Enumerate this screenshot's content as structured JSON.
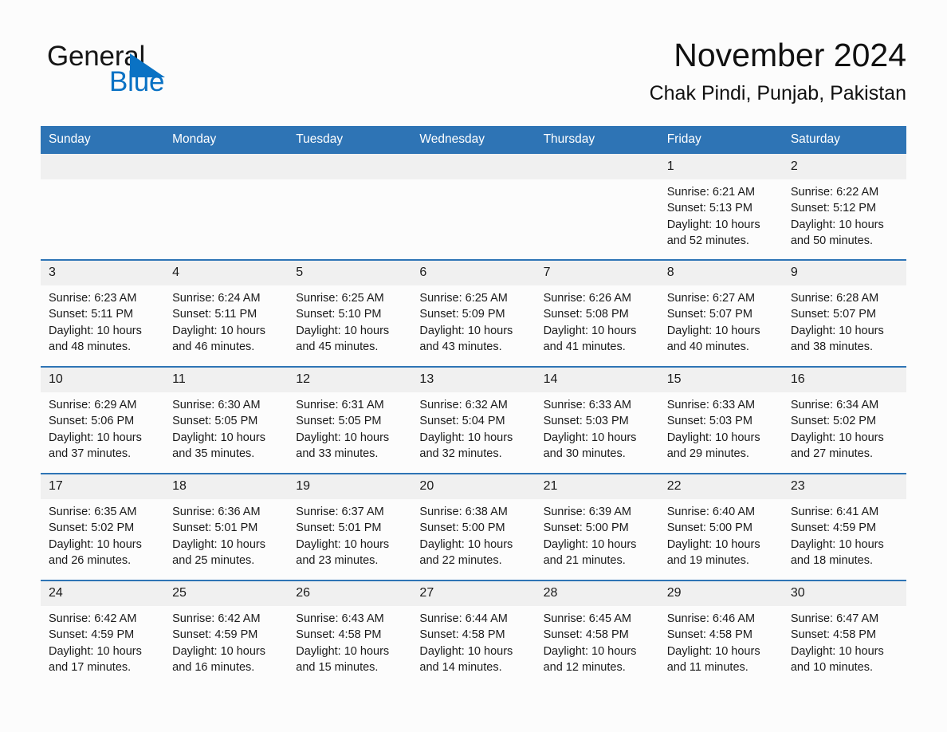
{
  "brand": {
    "name_part1": "General",
    "name_part2": "Blue",
    "triangle_icon": "triangle-logo-icon",
    "accent_color": "#0a72c4"
  },
  "header": {
    "title": "November 2024",
    "location": "Chak Pindi, Punjab, Pakistan"
  },
  "theme": {
    "header_blue": "#2e74b5",
    "row_border_blue": "#2e74b5",
    "daynum_band": "#f0f0f0",
    "page_background": "#fcfcfc"
  },
  "weekday_headers": [
    "Sunday",
    "Monday",
    "Tuesday",
    "Wednesday",
    "Thursday",
    "Friday",
    "Saturday"
  ],
  "weeks": [
    [
      {
        "day": "",
        "empty": true
      },
      {
        "day": "",
        "empty": true
      },
      {
        "day": "",
        "empty": true
      },
      {
        "day": "",
        "empty": true
      },
      {
        "day": "",
        "empty": true
      },
      {
        "day": "1",
        "sunrise": "Sunrise: 6:21 AM",
        "sunset": "Sunset: 5:13 PM",
        "daylight_line1": "Daylight: 10 hours",
        "daylight_line2": "and 52 minutes."
      },
      {
        "day": "2",
        "sunrise": "Sunrise: 6:22 AM",
        "sunset": "Sunset: 5:12 PM",
        "daylight_line1": "Daylight: 10 hours",
        "daylight_line2": "and 50 minutes."
      }
    ],
    [
      {
        "day": "3",
        "sunrise": "Sunrise: 6:23 AM",
        "sunset": "Sunset: 5:11 PM",
        "daylight_line1": "Daylight: 10 hours",
        "daylight_line2": "and 48 minutes."
      },
      {
        "day": "4",
        "sunrise": "Sunrise: 6:24 AM",
        "sunset": "Sunset: 5:11 PM",
        "daylight_line1": "Daylight: 10 hours",
        "daylight_line2": "and 46 minutes."
      },
      {
        "day": "5",
        "sunrise": "Sunrise: 6:25 AM",
        "sunset": "Sunset: 5:10 PM",
        "daylight_line1": "Daylight: 10 hours",
        "daylight_line2": "and 45 minutes."
      },
      {
        "day": "6",
        "sunrise": "Sunrise: 6:25 AM",
        "sunset": "Sunset: 5:09 PM",
        "daylight_line1": "Daylight: 10 hours",
        "daylight_line2": "and 43 minutes."
      },
      {
        "day": "7",
        "sunrise": "Sunrise: 6:26 AM",
        "sunset": "Sunset: 5:08 PM",
        "daylight_line1": "Daylight: 10 hours",
        "daylight_line2": "and 41 minutes."
      },
      {
        "day": "8",
        "sunrise": "Sunrise: 6:27 AM",
        "sunset": "Sunset: 5:07 PM",
        "daylight_line1": "Daylight: 10 hours",
        "daylight_line2": "and 40 minutes."
      },
      {
        "day": "9",
        "sunrise": "Sunrise: 6:28 AM",
        "sunset": "Sunset: 5:07 PM",
        "daylight_line1": "Daylight: 10 hours",
        "daylight_line2": "and 38 minutes."
      }
    ],
    [
      {
        "day": "10",
        "sunrise": "Sunrise: 6:29 AM",
        "sunset": "Sunset: 5:06 PM",
        "daylight_line1": "Daylight: 10 hours",
        "daylight_line2": "and 37 minutes."
      },
      {
        "day": "11",
        "sunrise": "Sunrise: 6:30 AM",
        "sunset": "Sunset: 5:05 PM",
        "daylight_line1": "Daylight: 10 hours",
        "daylight_line2": "and 35 minutes."
      },
      {
        "day": "12",
        "sunrise": "Sunrise: 6:31 AM",
        "sunset": "Sunset: 5:05 PM",
        "daylight_line1": "Daylight: 10 hours",
        "daylight_line2": "and 33 minutes."
      },
      {
        "day": "13",
        "sunrise": "Sunrise: 6:32 AM",
        "sunset": "Sunset: 5:04 PM",
        "daylight_line1": "Daylight: 10 hours",
        "daylight_line2": "and 32 minutes."
      },
      {
        "day": "14",
        "sunrise": "Sunrise: 6:33 AM",
        "sunset": "Sunset: 5:03 PM",
        "daylight_line1": "Daylight: 10 hours",
        "daylight_line2": "and 30 minutes."
      },
      {
        "day": "15",
        "sunrise": "Sunrise: 6:33 AM",
        "sunset": "Sunset: 5:03 PM",
        "daylight_line1": "Daylight: 10 hours",
        "daylight_line2": "and 29 minutes."
      },
      {
        "day": "16",
        "sunrise": "Sunrise: 6:34 AM",
        "sunset": "Sunset: 5:02 PM",
        "daylight_line1": "Daylight: 10 hours",
        "daylight_line2": "and 27 minutes."
      }
    ],
    [
      {
        "day": "17",
        "sunrise": "Sunrise: 6:35 AM",
        "sunset": "Sunset: 5:02 PM",
        "daylight_line1": "Daylight: 10 hours",
        "daylight_line2": "and 26 minutes."
      },
      {
        "day": "18",
        "sunrise": "Sunrise: 6:36 AM",
        "sunset": "Sunset: 5:01 PM",
        "daylight_line1": "Daylight: 10 hours",
        "daylight_line2": "and 25 minutes."
      },
      {
        "day": "19",
        "sunrise": "Sunrise: 6:37 AM",
        "sunset": "Sunset: 5:01 PM",
        "daylight_line1": "Daylight: 10 hours",
        "daylight_line2": "and 23 minutes."
      },
      {
        "day": "20",
        "sunrise": "Sunrise: 6:38 AM",
        "sunset": "Sunset: 5:00 PM",
        "daylight_line1": "Daylight: 10 hours",
        "daylight_line2": "and 22 minutes."
      },
      {
        "day": "21",
        "sunrise": "Sunrise: 6:39 AM",
        "sunset": "Sunset: 5:00 PM",
        "daylight_line1": "Daylight: 10 hours",
        "daylight_line2": "and 21 minutes."
      },
      {
        "day": "22",
        "sunrise": "Sunrise: 6:40 AM",
        "sunset": "Sunset: 5:00 PM",
        "daylight_line1": "Daylight: 10 hours",
        "daylight_line2": "and 19 minutes."
      },
      {
        "day": "23",
        "sunrise": "Sunrise: 6:41 AM",
        "sunset": "Sunset: 4:59 PM",
        "daylight_line1": "Daylight: 10 hours",
        "daylight_line2": "and 18 minutes."
      }
    ],
    [
      {
        "day": "24",
        "sunrise": "Sunrise: 6:42 AM",
        "sunset": "Sunset: 4:59 PM",
        "daylight_line1": "Daylight: 10 hours",
        "daylight_line2": "and 17 minutes."
      },
      {
        "day": "25",
        "sunrise": "Sunrise: 6:42 AM",
        "sunset": "Sunset: 4:59 PM",
        "daylight_line1": "Daylight: 10 hours",
        "daylight_line2": "and 16 minutes."
      },
      {
        "day": "26",
        "sunrise": "Sunrise: 6:43 AM",
        "sunset": "Sunset: 4:58 PM",
        "daylight_line1": "Daylight: 10 hours",
        "daylight_line2": "and 15 minutes."
      },
      {
        "day": "27",
        "sunrise": "Sunrise: 6:44 AM",
        "sunset": "Sunset: 4:58 PM",
        "daylight_line1": "Daylight: 10 hours",
        "daylight_line2": "and 14 minutes."
      },
      {
        "day": "28",
        "sunrise": "Sunrise: 6:45 AM",
        "sunset": "Sunset: 4:58 PM",
        "daylight_line1": "Daylight: 10 hours",
        "daylight_line2": "and 12 minutes."
      },
      {
        "day": "29",
        "sunrise": "Sunrise: 6:46 AM",
        "sunset": "Sunset: 4:58 PM",
        "daylight_line1": "Daylight: 10 hours",
        "daylight_line2": "and 11 minutes."
      },
      {
        "day": "30",
        "sunrise": "Sunrise: 6:47 AM",
        "sunset": "Sunset: 4:58 PM",
        "daylight_line1": "Daylight: 10 hours",
        "daylight_line2": "and 10 minutes."
      }
    ]
  ]
}
